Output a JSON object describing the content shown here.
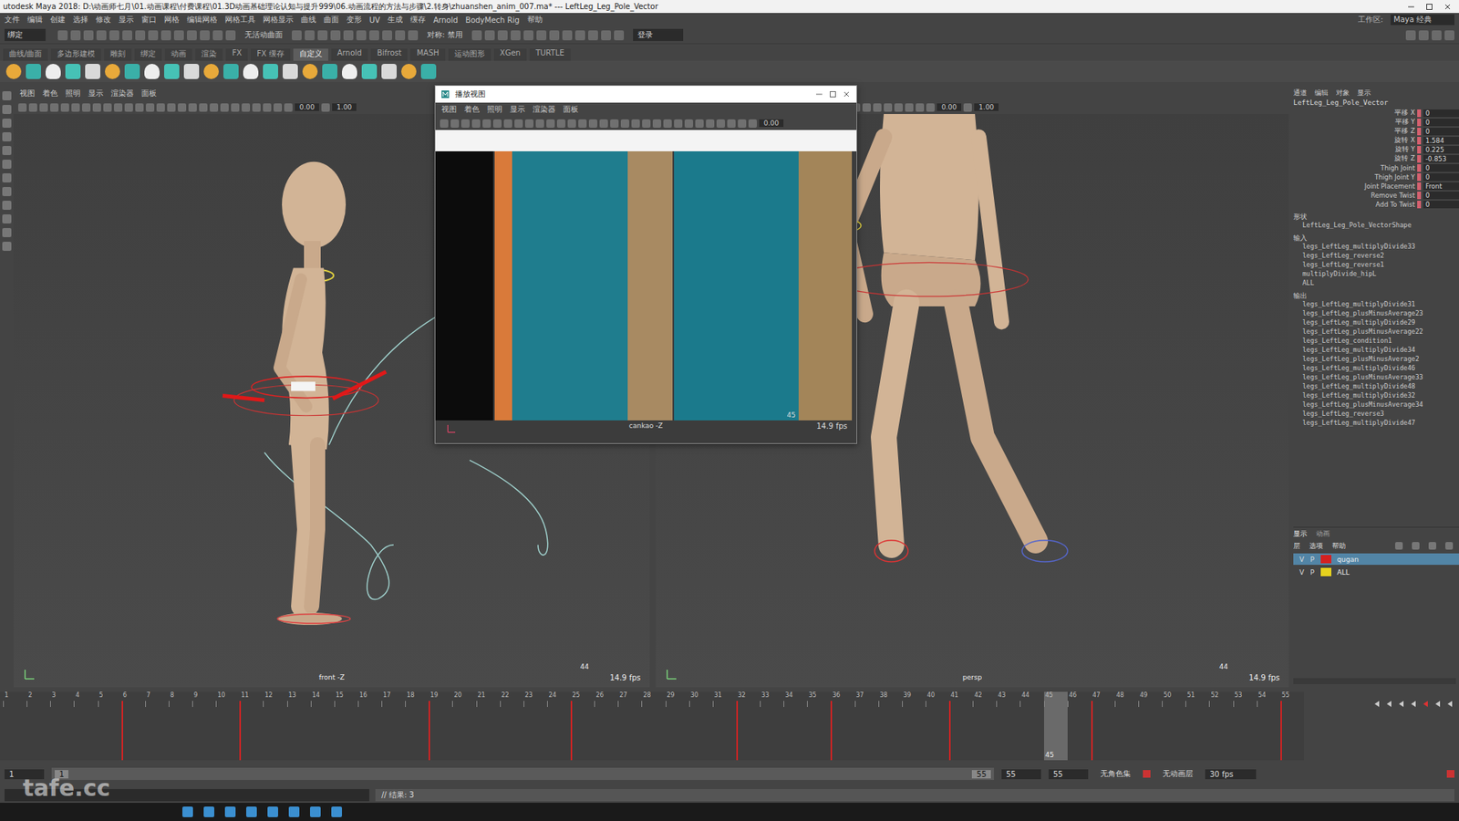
{
  "window": {
    "title": "utodesk Maya 2018: D:\\动画师七月\\01.动画课程\\付费课程\\01.3D动画基础理论认知与提升999\\06.动画流程的方法与步骤\\2.转身\\zhuanshen_anim_007.ma*  ---  LeftLeg_Leg_Pole_Vector"
  },
  "menu_bar": [
    "文件",
    "编辑",
    "创建",
    "选择",
    "修改",
    "显示",
    "窗口",
    "网格",
    "编辑网格",
    "网格工具",
    "网格显示",
    "曲线",
    "曲面",
    "变形",
    "UV",
    "生成",
    "缓存",
    "Arnold",
    "BodyMech Rig",
    "帮助"
  ],
  "workspace": {
    "label": "工作区:",
    "value": "Maya 经典"
  },
  "status_line": {
    "mode": "绑定",
    "surface": "无活动曲面",
    "symmetry": "对称: 禁用",
    "login": "登录"
  },
  "shelf_tabs": [
    {
      "label": "曲线/曲面",
      "selected": false
    },
    {
      "label": "多边形建模",
      "selected": false
    },
    {
      "label": "雕刻",
      "selected": false
    },
    {
      "label": "绑定",
      "selected": false
    },
    {
      "label": "动画",
      "selected": false
    },
    {
      "label": "渲染",
      "selected": false
    },
    {
      "label": "FX",
      "selected": false
    },
    {
      "label": "FX 缓存",
      "selected": false
    },
    {
      "label": "自定义",
      "selected": true
    },
    {
      "label": "Arnold",
      "selected": false
    },
    {
      "label": "Bifrost",
      "selected": false
    },
    {
      "label": "MASH",
      "selected": false
    },
    {
      "label": "运动图形",
      "selected": false
    },
    {
      "label": "XGen",
      "selected": false
    },
    {
      "label": "TURTLE",
      "selected": false
    }
  ],
  "panel_menu": [
    "视图",
    "着色",
    "照明",
    "显示",
    "渲染器",
    "面板"
  ],
  "panel_fields": [
    "0.00",
    "1.00"
  ],
  "viewports": [
    {
      "camera": "front -Z",
      "frame": "44",
      "fps": "14.9 fps"
    },
    {
      "camera": "persp",
      "frame": "44",
      "fps": "14.9 fps"
    }
  ],
  "playblast": {
    "title": "播放视图",
    "menu": [
      "视图",
      "着色",
      "照明",
      "显示",
      "渲染器",
      "面板"
    ],
    "field": "0.00",
    "camera": "cankao -Z",
    "frame": "45",
    "fps": "14.9 fps"
  },
  "channel_box": {
    "tabs": [
      "通道",
      "编辑",
      "对象",
      "显示"
    ],
    "object": "LeftLeg_Leg_Pole_Vector",
    "attributes": [
      {
        "label": "平移 X",
        "value": "0"
      },
      {
        "label": "平移 Y",
        "value": "0"
      },
      {
        "label": "平移 Z",
        "value": "0"
      },
      {
        "label": "旋转 X",
        "value": "1.584"
      },
      {
        "label": "旋转 Y",
        "value": "0.225"
      },
      {
        "label": "旋转 Z",
        "value": "-0.853"
      },
      {
        "label": "Thigh Joint",
        "value": "0"
      },
      {
        "label": "Thigh Joint Y",
        "value": "0"
      },
      {
        "label": "Joint Placement",
        "value": "Front"
      },
      {
        "label": "Remove Twist",
        "value": "0"
      },
      {
        "label": "Add To Twist",
        "value": "0"
      }
    ],
    "shapes_header": "形状",
    "shape": "LeftLeg_Leg_Pole_VectorShape",
    "inputs_header": "输入",
    "inputs": [
      "legs_LeftLeg_multiplyDivide33",
      "legs_LeftLeg_reverse2",
      "legs_LeftLeg_reverse1",
      "multiplyDivide_hipL",
      "ALL"
    ],
    "outputs_header": "输出",
    "outputs": [
      "legs_LeftLeg_multiplyDivide31",
      "legs_LeftLeg_plusMinusAverage23",
      "legs_LeftLeg_multiplyDivide29",
      "legs_LeftLeg_plusMinusAverage22",
      "legs_LeftLeg_condition1",
      "legs_LeftLeg_multiplyDivide34",
      "legs_LeftLeg_plusMinusAverage2",
      "legs_LeftLeg_multiplyDivide46",
      "legs_LeftLeg_plusMinusAverage33",
      "legs_LeftLeg_multiplyDivide48",
      "legs_LeftLeg_multiplyDivide32",
      "legs_LeftLeg_plusMinusAverage34",
      "legs_LeftLeg_reverse3",
      "legs_LeftLeg_multiplyDivide47"
    ]
  },
  "layer_editor": {
    "tabs": [
      {
        "label": "显示",
        "selected": true
      },
      {
        "label": "动画",
        "selected": false
      }
    ],
    "menu": [
      "层",
      "选项",
      "帮助"
    ],
    "layers": [
      {
        "v": "V",
        "p": "P",
        "name": "qugan",
        "color": "#d42020",
        "selected": true
      },
      {
        "v": "V",
        "p": "P",
        "name": "ALL",
        "color": "#e6d21e",
        "selected": false
      }
    ]
  },
  "timeline": {
    "ticks": [
      "1",
      "2",
      "3",
      "4",
      "5",
      "6",
      "7",
      "8",
      "9",
      "10",
      "11",
      "12",
      "13",
      "14",
      "15",
      "16",
      "17",
      "18",
      "19",
      "20",
      "21",
      "22",
      "23",
      "24",
      "25",
      "26",
      "27",
      "28",
      "29",
      "30",
      "31",
      "32",
      "33",
      "34",
      "35",
      "36",
      "37",
      "38",
      "39",
      "40",
      "41",
      "42",
      "43",
      "44",
      "45",
      "46",
      "47",
      "48",
      "49",
      "50",
      "51",
      "52",
      "53",
      "54",
      "55"
    ],
    "keys": [
      6,
      11,
      19,
      25,
      32,
      36,
      41,
      47,
      55
    ],
    "current": "45"
  },
  "range": {
    "start": "1",
    "inner_start": "1",
    "inner_end": "55",
    "end": "55",
    "end2": "55",
    "character_set": "无角色集",
    "anim_layer": "无动画层",
    "fps": "30 fps"
  },
  "command_line": {
    "result": "// 结果: 3"
  },
  "watermark": "tafe.cc"
}
